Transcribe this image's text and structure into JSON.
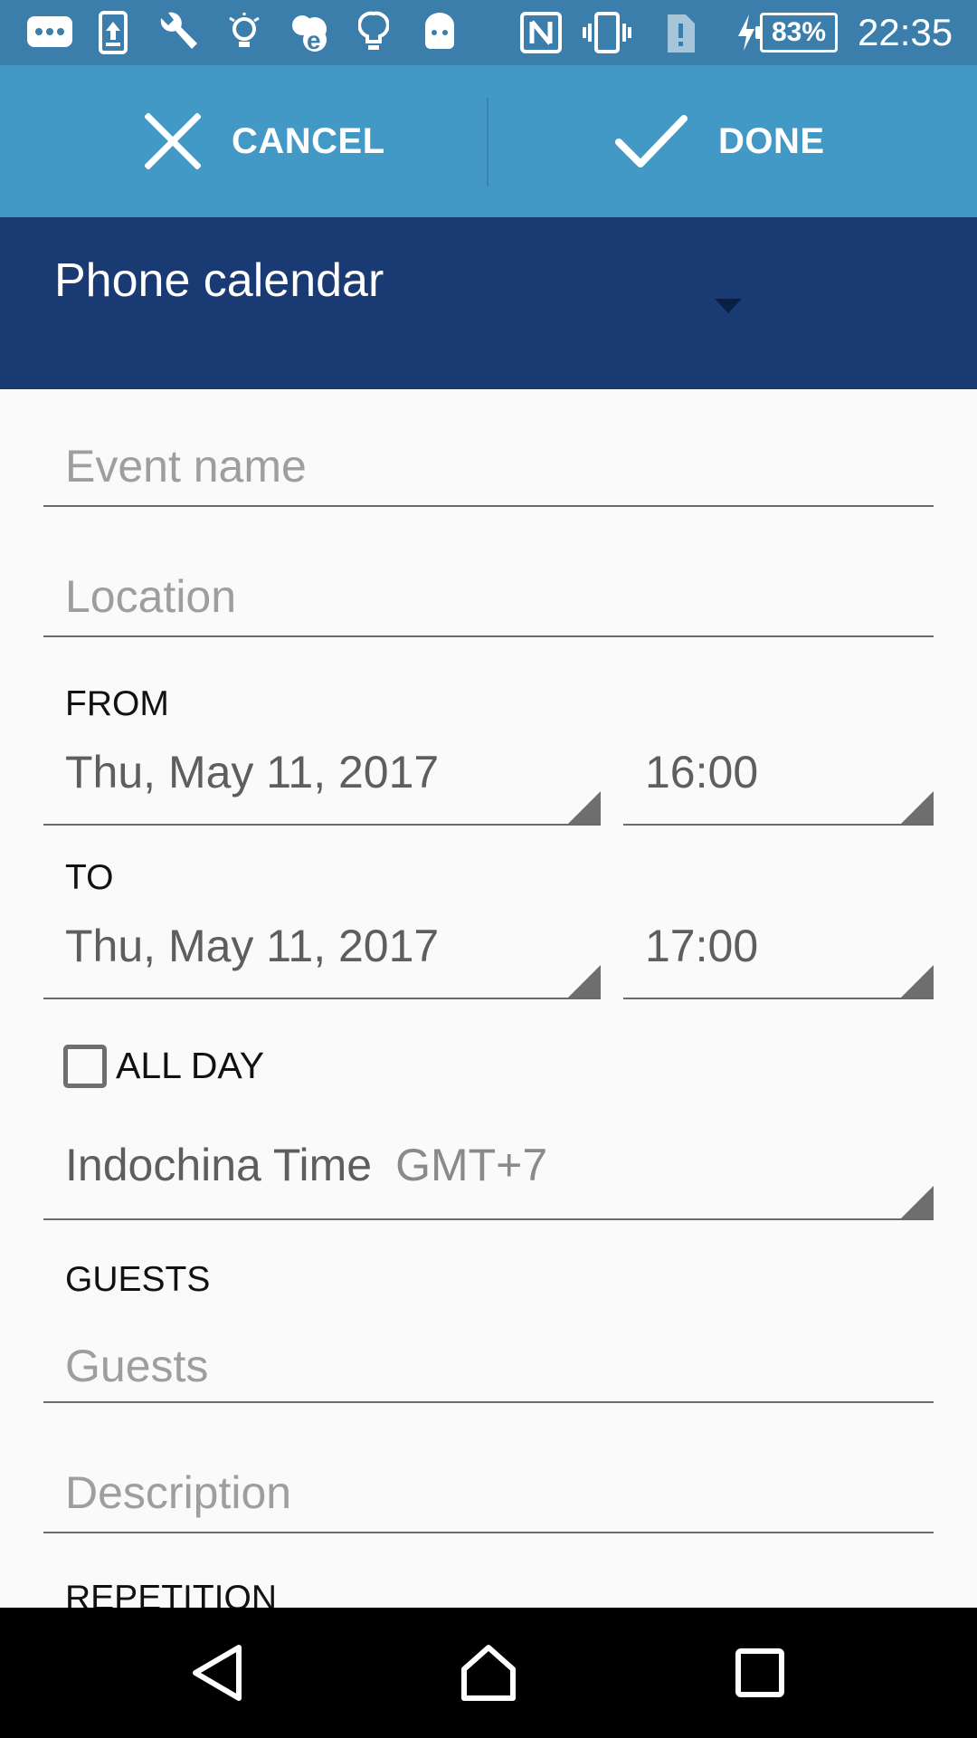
{
  "status_bar": {
    "battery_percent": "83%",
    "time": "22:35",
    "icons": [
      "chat-icon",
      "upload-icon",
      "wrench-icon",
      "bulb-icon",
      "cloud-e-icon",
      "lightbulb-icon",
      "android-icon",
      "nfc-icon",
      "vibrate-icon",
      "sim-alert-icon",
      "charging-icon",
      "battery-icon"
    ]
  },
  "action_bar": {
    "cancel_label": "CANCEL",
    "done_label": "DONE"
  },
  "calendar": {
    "name": "Phone calendar"
  },
  "form": {
    "event_name_placeholder": "Event name",
    "location_placeholder": "Location",
    "from_label": "FROM",
    "from_date": "Thu, May 11, 2017",
    "from_time": "16:00",
    "to_label": "TO",
    "to_date": "Thu, May 11, 2017",
    "to_time": "17:00",
    "all_day_label": "ALL DAY",
    "all_day_checked": false,
    "timezone_name": "Indochina Time",
    "timezone_offset": "GMT+7",
    "guests_label": "GUESTS",
    "guests_placeholder": "Guests",
    "description_placeholder": "Description",
    "repetition_label": "REPETITION"
  },
  "nav_bar": {
    "buttons": [
      "back-icon",
      "home-icon",
      "recents-icon"
    ]
  },
  "colors": {
    "status_bar": "#3c7eab",
    "action_bar": "#4399c6",
    "calendar_bar": "#193a73",
    "background": "#fafafa"
  }
}
